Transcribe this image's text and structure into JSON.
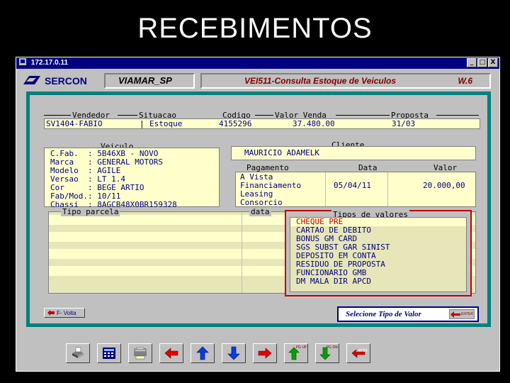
{
  "slide": {
    "title": "RECEBIMENTOS"
  },
  "window": {
    "title": "172.17.0.11",
    "controls": [
      "_",
      "□",
      "X"
    ]
  },
  "header": {
    "logo_text": "SERCON",
    "company": "VIAMAR_SP",
    "screen_title": "VEI511-Consulta Estoque de Veiculos",
    "version": "W.6"
  },
  "top_fields": {
    "labels": {
      "vendedor": "Vendedor",
      "situacao": "Situacao",
      "codigo": "Codigo",
      "valor_venda": "Valor Venda",
      "proposta": "Proposta"
    },
    "values": {
      "vendedor": "SV1404-FABIO",
      "situacao": "Estoque",
      "codigo": "4155296",
      "valor_venda": "37.480.00",
      "proposta": "31/03"
    }
  },
  "veiculo": {
    "legend": "Veiculo",
    "rows": [
      "C.Fab.  : 5B46XB - NOVO",
      "Marca   : GENERAL MOTORS",
      "Modelo  : AGILE",
      "Versao  : LT 1.4",
      "Cor     : BEGE ARTIO",
      "Fab/Mod.: 10/11",
      "Chassi  : 8AGCB48X0BR159328"
    ]
  },
  "cliente": {
    "legend": "Cliente",
    "name": "MAURICIO ADAMELK"
  },
  "pagamento": {
    "headers": {
      "pagamento": "Pagamento",
      "data": "Data",
      "valor": "Valor"
    },
    "rows": [
      {
        "tipo": "A Vista",
        "data": "",
        "valor": ""
      },
      {
        "tipo": "Financiamento",
        "data": "05/04/11",
        "valor": "20.000,00"
      },
      {
        "tipo": "Leasing",
        "data": "",
        "valor": ""
      },
      {
        "tipo": "Consorcio",
        "data": "",
        "valor": ""
      }
    ]
  },
  "parcelas": {
    "tipo_parcela_label": "Tipo parcela",
    "data_label": "data"
  },
  "tipos_valores": {
    "legend": "Tipos de valores",
    "selected_index": 0,
    "items": [
      "CHEQUE PRE",
      "CARTAO DE DEBITO",
      "BONUS GM CARD",
      "SGS SUBST GAR SINIST",
      "DEPOSITO EM CONTA",
      "RESIDUO DE PROPOSTA",
      "FUNCIONARIO GMB",
      "DM MALA DIR APCD"
    ]
  },
  "footer": {
    "volta_label": "F- Volta",
    "status_message": "Selecione Tipo de Valor",
    "enter_label": "ENTER"
  },
  "toolbar": {
    "buttons": [
      {
        "icon": "print-icon"
      },
      {
        "icon": "calculator-icon"
      },
      {
        "icon": "printer-stack-icon"
      },
      {
        "icon": "arrow-left-icon"
      },
      {
        "icon": "arrow-up-icon"
      },
      {
        "icon": "arrow-down-icon"
      },
      {
        "icon": "arrow-right-icon"
      },
      {
        "icon": "page-up-icon",
        "tag": "PG UP"
      },
      {
        "icon": "page-down-icon",
        "tag": "PG DN"
      },
      {
        "icon": "enter-icon",
        "tag": "ENTER"
      }
    ]
  },
  "colors": {
    "frame_teal": "#008080",
    "field_yellow": "#ffffcc",
    "navy": "#000080",
    "red": "#c00000"
  }
}
